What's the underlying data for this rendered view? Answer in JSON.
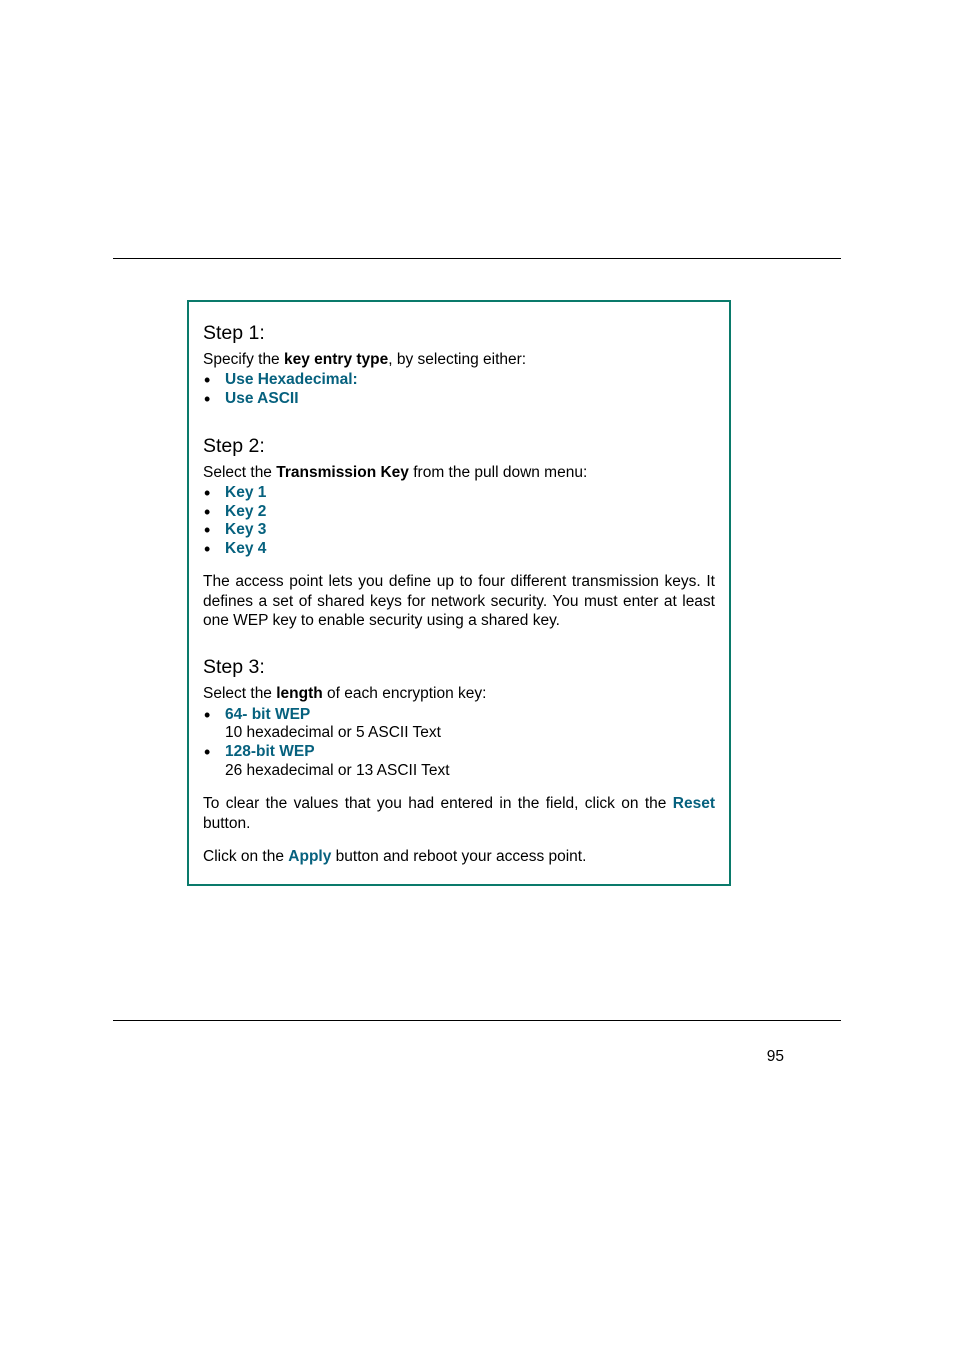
{
  "step1": {
    "title": "Step 1:",
    "intro_pre": "Specify the ",
    "intro_bold": "key entry type",
    "intro_post": ", by selecting either:",
    "bullets": [
      "Use Hexadecimal:",
      "Use ASCII"
    ]
  },
  "step2": {
    "title": "Step 2:",
    "intro_pre": "Select the ",
    "intro_bold": "Transmission Key",
    "intro_post": " from the pull down menu:",
    "bullets": [
      "Key 1",
      "Key 2",
      "Key 3",
      "Key 4"
    ],
    "para": "The access point lets you define up to four different transmission keys. It defines a set of shared keys for network security. You must enter at least one WEP key to enable security using a shared key."
  },
  "step3": {
    "title": "Step 3:",
    "intro_pre": "Select the ",
    "intro_bold": "length",
    "intro_post": " of each encryption key:",
    "bullets": [
      {
        "label": "64- bit WEP",
        "sub": "10 hexadecimal or 5 ASCII Text"
      },
      {
        "label": "128-bit WEP",
        "sub": "26 hexadecimal or 13 ASCII Text"
      }
    ],
    "reset_pre": "To clear the values that you had entered in the field, click on the ",
    "reset_bold": "Reset",
    "reset_post": " button.",
    "apply_pre": "Click on the ",
    "apply_bold": "Apply",
    "apply_post": " button and reboot your access point."
  },
  "page_number": "95"
}
